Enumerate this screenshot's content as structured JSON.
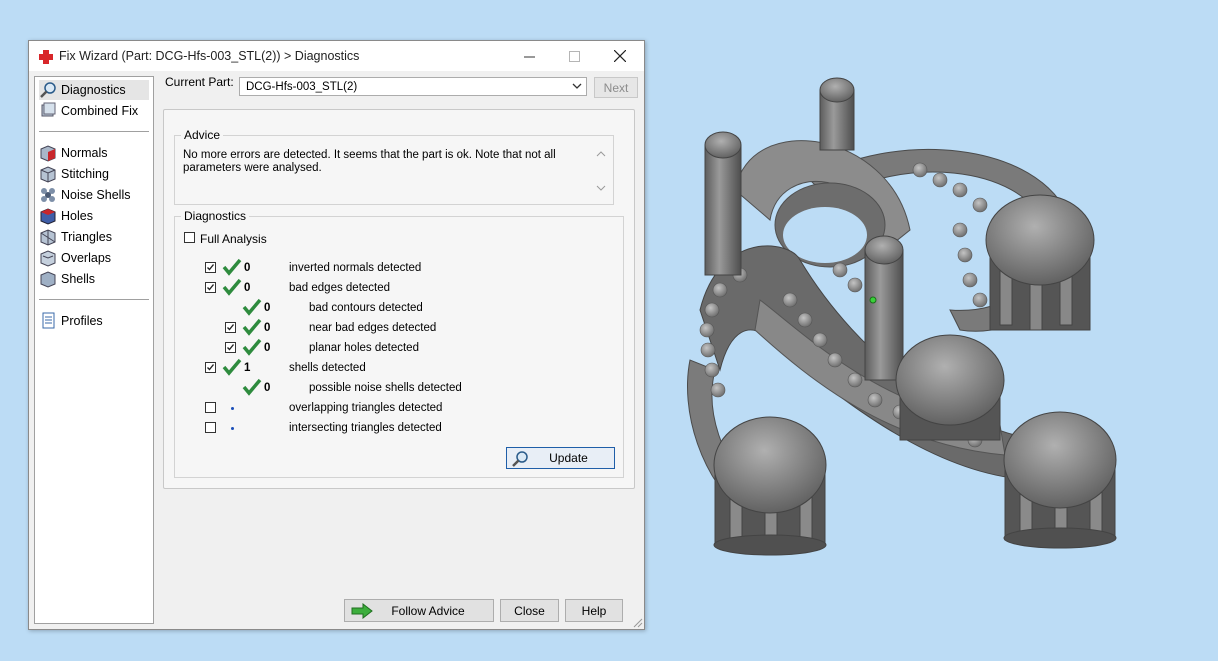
{
  "window": {
    "title": "Fix Wizard (Part: DCG-Hfs-003_STL(2)) > Diagnostics",
    "icon": "red-cross-icon"
  },
  "sidebar": {
    "items": [
      {
        "label": "Diagnostics",
        "icon": "magnifier-icon",
        "selected": true
      },
      {
        "label": "Combined Fix",
        "icon": "combined-fix-icon"
      },
      {
        "label": "Normals",
        "icon": "normals-cube-icon"
      },
      {
        "label": "Stitching",
        "icon": "stitching-cube-icon"
      },
      {
        "label": "Noise Shells",
        "icon": "noise-shells-icon"
      },
      {
        "label": "Holes",
        "icon": "holes-cube-icon"
      },
      {
        "label": "Triangles",
        "icon": "triangles-cube-icon"
      },
      {
        "label": "Overlaps",
        "icon": "overlaps-cube-icon"
      },
      {
        "label": "Shells",
        "icon": "shells-cube-icon"
      },
      {
        "label": "Profiles",
        "icon": "document-icon"
      }
    ]
  },
  "current_part": {
    "label": "Current Part:",
    "value": "DCG-Hfs-003_STL(2)",
    "next_label": "Next"
  },
  "advice": {
    "legend": "Advice",
    "text": "No more errors are detected. It seems that the part is ok. Note that not all parameters were analysed."
  },
  "diagnostics": {
    "legend": "Diagnostics",
    "full_analysis_label": "Full Analysis",
    "full_analysis_checked": false,
    "rows": [
      {
        "checkbox": true,
        "checked": true,
        "status": "ok",
        "count": "0",
        "label": "inverted normals detected",
        "indent": 0
      },
      {
        "checkbox": true,
        "checked": true,
        "status": "ok",
        "count": "0",
        "label": "bad edges detected",
        "indent": 0
      },
      {
        "checkbox": false,
        "checked": false,
        "status": "ok",
        "count": "0",
        "label": "bad contours detected",
        "indent": 1
      },
      {
        "checkbox": true,
        "checked": true,
        "status": "ok",
        "count": "0",
        "label": "near bad edges detected",
        "indent": 1
      },
      {
        "checkbox": true,
        "checked": true,
        "status": "ok",
        "count": "0",
        "label": "planar holes detected",
        "indent": 1
      },
      {
        "checkbox": true,
        "checked": true,
        "status": "ok",
        "count": "1",
        "label": "shells detected",
        "indent": 0
      },
      {
        "checkbox": false,
        "checked": false,
        "status": "ok",
        "count": "0",
        "label": "possible noise shells detected",
        "indent": 1
      },
      {
        "checkbox": true,
        "checked": false,
        "status": "pending",
        "count": "",
        "label": "overlapping triangles detected",
        "indent": 0
      },
      {
        "checkbox": true,
        "checked": false,
        "status": "pending",
        "count": "",
        "label": "intersecting triangles detected",
        "indent": 0
      }
    ],
    "update_label": "Update"
  },
  "footer": {
    "follow_advice_label": "Follow Advice",
    "close_label": "Close",
    "help_label": "Help"
  },
  "colors": {
    "check_green": "#2e8b3e",
    "accent_blue": "#1f5ea8",
    "viewport_bg": "#bcdcf5"
  }
}
